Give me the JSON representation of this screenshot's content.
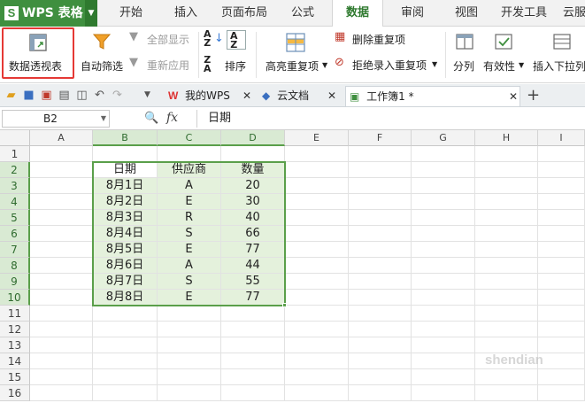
{
  "app": {
    "logo": "S",
    "title": "WPS 表格"
  },
  "menu_tabs": [
    "开始",
    "插入",
    "页面布局",
    "公式",
    "数据",
    "审阅",
    "视图",
    "开发工具",
    "云服"
  ],
  "active_menu_tab": "数据",
  "ribbon": {
    "pivot": "数据透视表",
    "autofilter": "自动筛选",
    "show_all": "全部显示",
    "reapply": "重新应用",
    "sort": "排序",
    "highlight_dup": "高亮重复项",
    "delete_dup": "删除重复项",
    "reject_dup": "拒绝录入重复项",
    "split": "分列",
    "validity": "有效性",
    "dropdown_list": "插入下拉列"
  },
  "doc_tabs": [
    {
      "label": "我的WPS",
      "icon": "wps-icon"
    },
    {
      "label": "云文档",
      "icon": "cloud-doc-icon"
    },
    {
      "label": "工作簿1 *",
      "icon": "workbook-icon"
    }
  ],
  "formula_bar": {
    "name_box": "B2",
    "fx": "fx",
    "content": "日期"
  },
  "grid": {
    "columns": [
      "A",
      "B",
      "C",
      "D",
      "E",
      "F",
      "G",
      "H",
      "I"
    ],
    "rows": [
      "1",
      "2",
      "3",
      "4",
      "5",
      "6",
      "7",
      "8",
      "9",
      "10",
      "11",
      "12",
      "13",
      "14",
      "15",
      "16"
    ],
    "headers": [
      "日期",
      "供应商",
      "数量"
    ],
    "data": [
      [
        "8月1日",
        "A",
        "20"
      ],
      [
        "8月2日",
        "E",
        "30"
      ],
      [
        "8月3日",
        "R",
        "40"
      ],
      [
        "8月4日",
        "S",
        "66"
      ],
      [
        "8月5日",
        "E",
        "77"
      ],
      [
        "8月6日",
        "A",
        "44"
      ],
      [
        "8月7日",
        "S",
        "55"
      ],
      [
        "8月8日",
        "E",
        "77"
      ]
    ]
  },
  "colors": {
    "accent": "#3f8f3f",
    "selection": "#5a9f4a",
    "highlight": "#e53935"
  }
}
